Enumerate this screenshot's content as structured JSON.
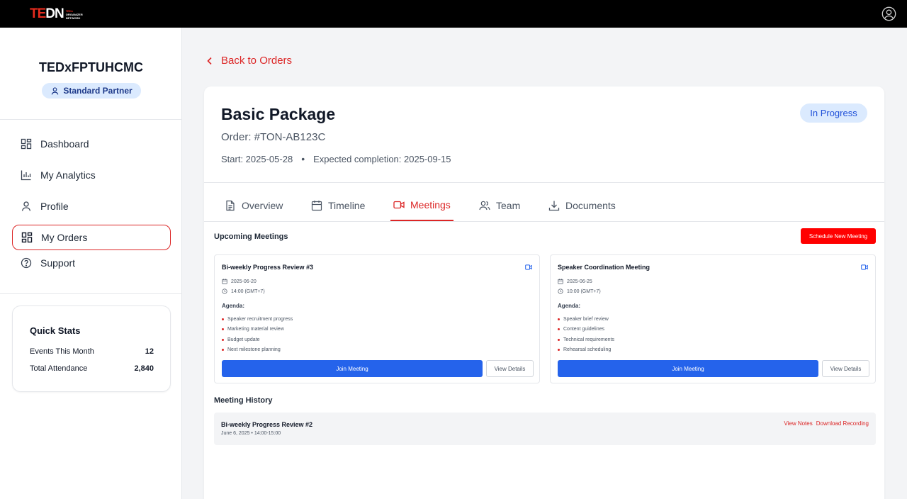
{
  "brand": {
    "logo_main_a": "TE",
    "logo_main_b": "DN",
    "logo_small": [
      "TEDx",
      "ORGANIZER",
      "NETWORK"
    ]
  },
  "sidebar": {
    "org_name": "TEDxFPTUHCMC",
    "partner_label": "Standard Partner",
    "nav": [
      {
        "label": "Dashboard",
        "icon": "dashboard-icon"
      },
      {
        "label": "My Analytics",
        "icon": "bar-chart-icon"
      },
      {
        "label": "Profile",
        "icon": "user-icon"
      },
      {
        "label": "My Orders",
        "icon": "orders-icon",
        "active": true
      },
      {
        "label": "Support",
        "icon": "help-circle-icon"
      }
    ],
    "quick_stats": {
      "title": "Quick Stats",
      "rows": [
        {
          "label": "Events This Month",
          "value": "12"
        },
        {
          "label": "Total Attendance",
          "value": "2,840"
        }
      ]
    }
  },
  "main": {
    "back_label": "Back to Orders",
    "order": {
      "package": "Basic Package",
      "order_id": "Order: #TON-AB123C",
      "start": "Start: 2025-05-28",
      "expected": "Expected completion: 2025-09-15",
      "status": "In Progress"
    },
    "tabs": [
      {
        "label": "Overview",
        "icon": "document-icon"
      },
      {
        "label": "Timeline",
        "icon": "calendar-icon"
      },
      {
        "label": "Meetings",
        "icon": "video-icon",
        "active": true
      },
      {
        "label": "Team",
        "icon": "users-icon"
      },
      {
        "label": "Documents",
        "icon": "download-icon"
      }
    ],
    "upcoming_title": "Upcoming Meetings",
    "schedule_label": "Schedule New Meeting",
    "meetings": [
      {
        "title": "Bi-weekly Progress Review #3",
        "date": "2025-06-20",
        "time": "14:00 (GMT+7)",
        "agenda_label": "Agenda:",
        "agenda": [
          "Speaker recruitment progress",
          "Marketing material review",
          "Budget update",
          "Next milestone planning"
        ],
        "join_label": "Join Meeting",
        "details_label": "View Details"
      },
      {
        "title": "Speaker Coordination Meeting",
        "date": "2025-06-25",
        "time": "10:00 (GMT+7)",
        "agenda_label": "Agenda:",
        "agenda": [
          "Speaker brief review",
          "Content guidelines",
          "Technical requirements",
          "Rehearsal scheduling"
        ],
        "join_label": "Join Meeting",
        "details_label": "View Details"
      }
    ],
    "history_title": "Meeting History",
    "history": [
      {
        "title": "Bi-weekly Progress Review #2",
        "subtitle": "June 6, 2025 • 14:00-15:00",
        "notes_label": "View Notes",
        "recording_label": "Download Recording"
      }
    ]
  },
  "colors": {
    "accent": "#dc2626",
    "primary_button": "#2563eb",
    "status_bg": "#dbeafe",
    "schedule_button": "#ff0000"
  }
}
